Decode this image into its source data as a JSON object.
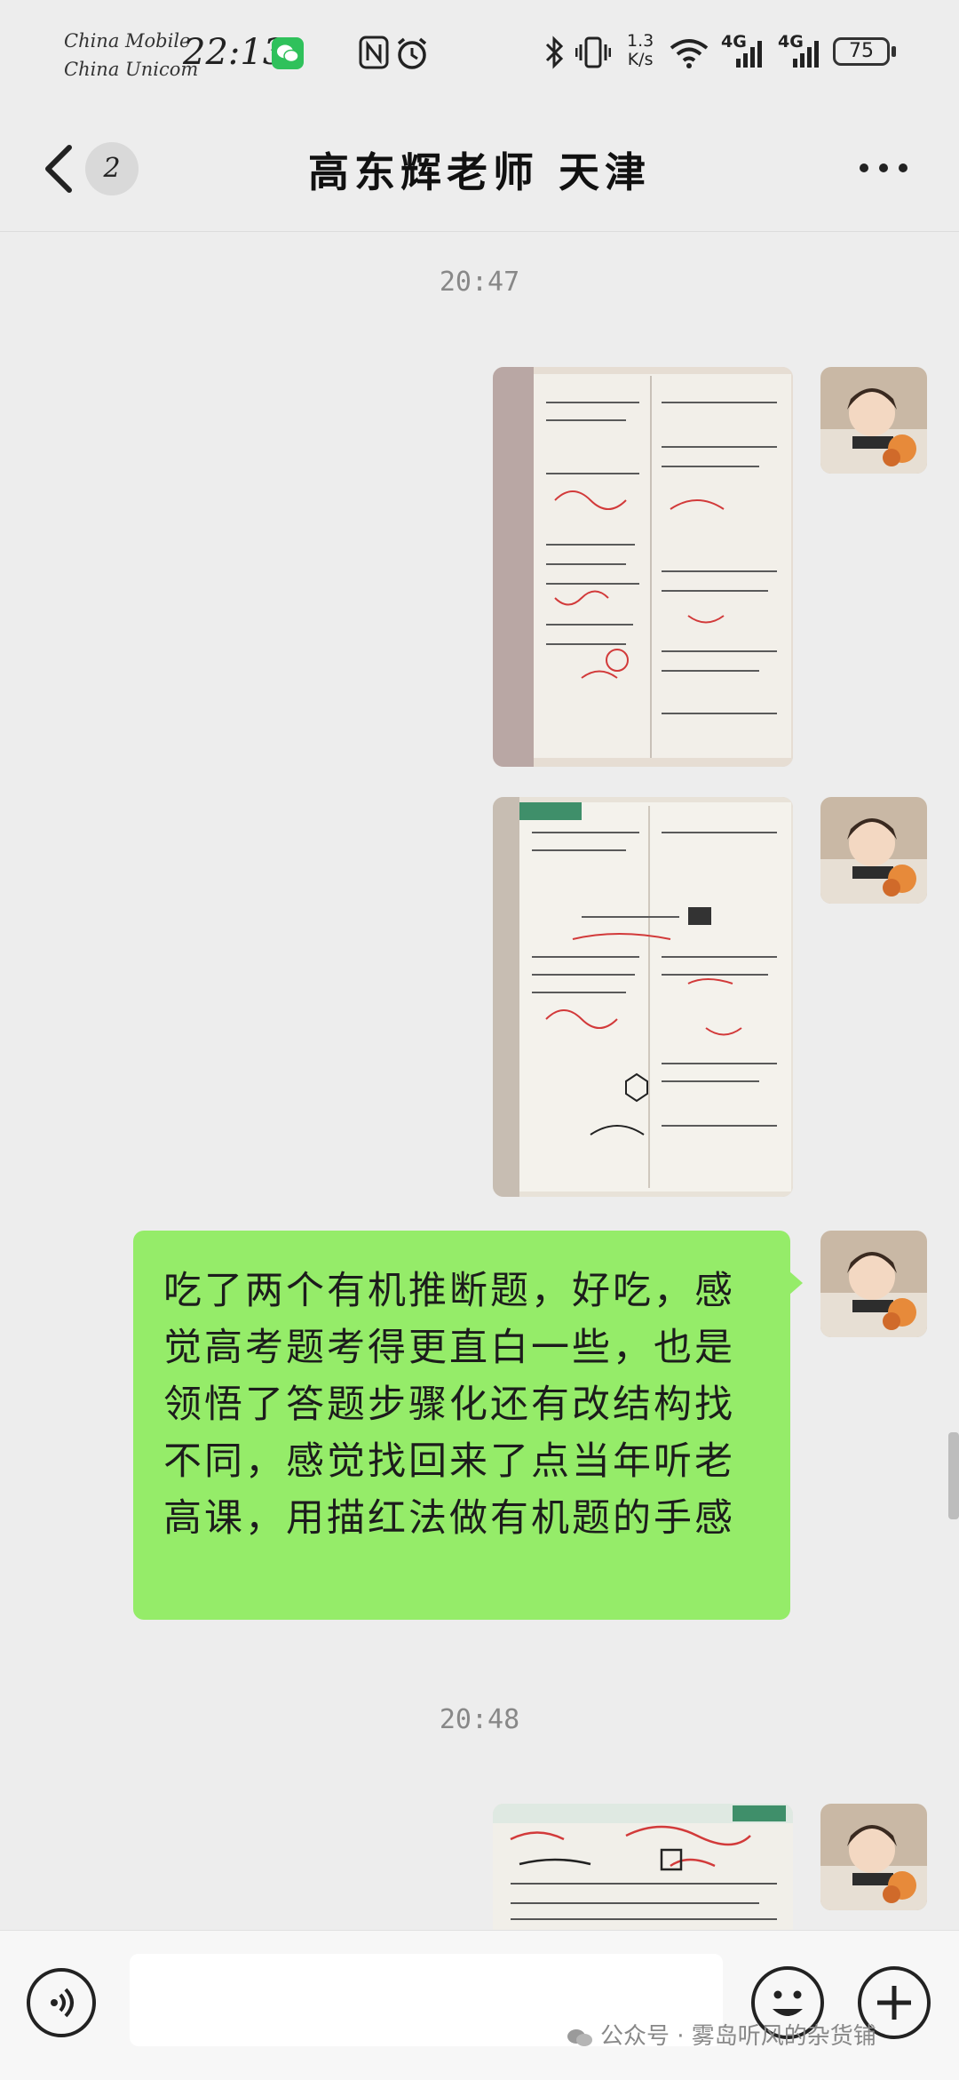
{
  "status_bar": {
    "carrier_1": "China Mobile",
    "carrier_2": "China Unicom",
    "time": "22:13",
    "net_speed_value": "1.3",
    "net_speed_unit": "K/s",
    "signal_1_label": "4G",
    "signal_2_label": "4G",
    "battery": "75"
  },
  "header": {
    "unread_count": "2",
    "title": "高东辉老师 天津"
  },
  "chat": {
    "timestamp_1": "20:47",
    "timestamp_2": "20:48",
    "message_text": "吃了两个有机推断题，好吃，感觉高考题考得更直白一些，也是领悟了答题步骤化还有改结构找不同，感觉找回来了点当年听老高课，用描红法做有机题的手感"
  },
  "input_bar": {
    "placeholder": ""
  },
  "watermark": "公众号 · 雾岛听风的杂货铺",
  "colors": {
    "background": "#ededed",
    "bubble_green": "#95ec69",
    "wechat_green": "#2fc15b"
  },
  "icons": [
    "back-arrow-icon",
    "more-icon",
    "voice-icon",
    "emoji-icon",
    "plus-icon",
    "wechat-icon",
    "nfc-icon",
    "alarm-icon",
    "bluetooth-icon",
    "vibrate-icon",
    "wifi-icon",
    "signal-icon",
    "battery-icon"
  ]
}
